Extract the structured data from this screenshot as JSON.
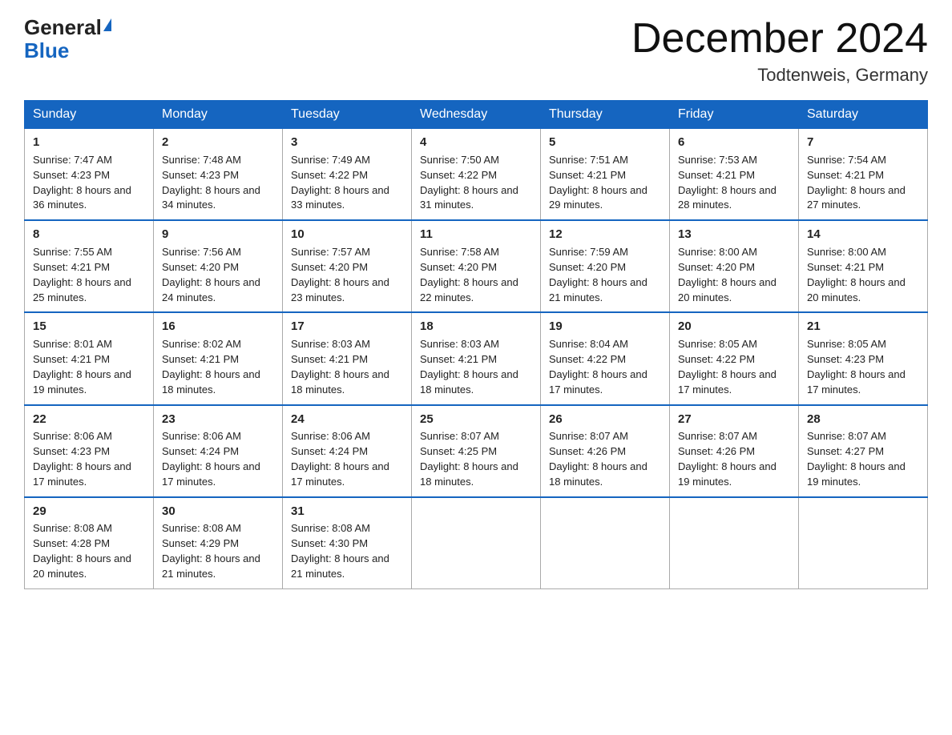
{
  "header": {
    "logo_general": "General",
    "logo_blue": "Blue",
    "month_title": "December 2024",
    "location": "Todtenweis, Germany"
  },
  "weekdays": [
    "Sunday",
    "Monday",
    "Tuesday",
    "Wednesday",
    "Thursday",
    "Friday",
    "Saturday"
  ],
  "weeks": [
    [
      {
        "day": "1",
        "sunrise": "7:47 AM",
        "sunset": "4:23 PM",
        "daylight": "8 hours and 36 minutes."
      },
      {
        "day": "2",
        "sunrise": "7:48 AM",
        "sunset": "4:23 PM",
        "daylight": "8 hours and 34 minutes."
      },
      {
        "day": "3",
        "sunrise": "7:49 AM",
        "sunset": "4:22 PM",
        "daylight": "8 hours and 33 minutes."
      },
      {
        "day": "4",
        "sunrise": "7:50 AM",
        "sunset": "4:22 PM",
        "daylight": "8 hours and 31 minutes."
      },
      {
        "day": "5",
        "sunrise": "7:51 AM",
        "sunset": "4:21 PM",
        "daylight": "8 hours and 29 minutes."
      },
      {
        "day": "6",
        "sunrise": "7:53 AM",
        "sunset": "4:21 PM",
        "daylight": "8 hours and 28 minutes."
      },
      {
        "day": "7",
        "sunrise": "7:54 AM",
        "sunset": "4:21 PM",
        "daylight": "8 hours and 27 minutes."
      }
    ],
    [
      {
        "day": "8",
        "sunrise": "7:55 AM",
        "sunset": "4:21 PM",
        "daylight": "8 hours and 25 minutes."
      },
      {
        "day": "9",
        "sunrise": "7:56 AM",
        "sunset": "4:20 PM",
        "daylight": "8 hours and 24 minutes."
      },
      {
        "day": "10",
        "sunrise": "7:57 AM",
        "sunset": "4:20 PM",
        "daylight": "8 hours and 23 minutes."
      },
      {
        "day": "11",
        "sunrise": "7:58 AM",
        "sunset": "4:20 PM",
        "daylight": "8 hours and 22 minutes."
      },
      {
        "day": "12",
        "sunrise": "7:59 AM",
        "sunset": "4:20 PM",
        "daylight": "8 hours and 21 minutes."
      },
      {
        "day": "13",
        "sunrise": "8:00 AM",
        "sunset": "4:20 PM",
        "daylight": "8 hours and 20 minutes."
      },
      {
        "day": "14",
        "sunrise": "8:00 AM",
        "sunset": "4:21 PM",
        "daylight": "8 hours and 20 minutes."
      }
    ],
    [
      {
        "day": "15",
        "sunrise": "8:01 AM",
        "sunset": "4:21 PM",
        "daylight": "8 hours and 19 minutes."
      },
      {
        "day": "16",
        "sunrise": "8:02 AM",
        "sunset": "4:21 PM",
        "daylight": "8 hours and 18 minutes."
      },
      {
        "day": "17",
        "sunrise": "8:03 AM",
        "sunset": "4:21 PM",
        "daylight": "8 hours and 18 minutes."
      },
      {
        "day": "18",
        "sunrise": "8:03 AM",
        "sunset": "4:21 PM",
        "daylight": "8 hours and 18 minutes."
      },
      {
        "day": "19",
        "sunrise": "8:04 AM",
        "sunset": "4:22 PM",
        "daylight": "8 hours and 17 minutes."
      },
      {
        "day": "20",
        "sunrise": "8:05 AM",
        "sunset": "4:22 PM",
        "daylight": "8 hours and 17 minutes."
      },
      {
        "day": "21",
        "sunrise": "8:05 AM",
        "sunset": "4:23 PM",
        "daylight": "8 hours and 17 minutes."
      }
    ],
    [
      {
        "day": "22",
        "sunrise": "8:06 AM",
        "sunset": "4:23 PM",
        "daylight": "8 hours and 17 minutes."
      },
      {
        "day": "23",
        "sunrise": "8:06 AM",
        "sunset": "4:24 PM",
        "daylight": "8 hours and 17 minutes."
      },
      {
        "day": "24",
        "sunrise": "8:06 AM",
        "sunset": "4:24 PM",
        "daylight": "8 hours and 17 minutes."
      },
      {
        "day": "25",
        "sunrise": "8:07 AM",
        "sunset": "4:25 PM",
        "daylight": "8 hours and 18 minutes."
      },
      {
        "day": "26",
        "sunrise": "8:07 AM",
        "sunset": "4:26 PM",
        "daylight": "8 hours and 18 minutes."
      },
      {
        "day": "27",
        "sunrise": "8:07 AM",
        "sunset": "4:26 PM",
        "daylight": "8 hours and 19 minutes."
      },
      {
        "day": "28",
        "sunrise": "8:07 AM",
        "sunset": "4:27 PM",
        "daylight": "8 hours and 19 minutes."
      }
    ],
    [
      {
        "day": "29",
        "sunrise": "8:08 AM",
        "sunset": "4:28 PM",
        "daylight": "8 hours and 20 minutes."
      },
      {
        "day": "30",
        "sunrise": "8:08 AM",
        "sunset": "4:29 PM",
        "daylight": "8 hours and 21 minutes."
      },
      {
        "day": "31",
        "sunrise": "8:08 AM",
        "sunset": "4:30 PM",
        "daylight": "8 hours and 21 minutes."
      },
      null,
      null,
      null,
      null
    ]
  ],
  "labels": {
    "sunrise": "Sunrise:",
    "sunset": "Sunset:",
    "daylight": "Daylight:"
  }
}
